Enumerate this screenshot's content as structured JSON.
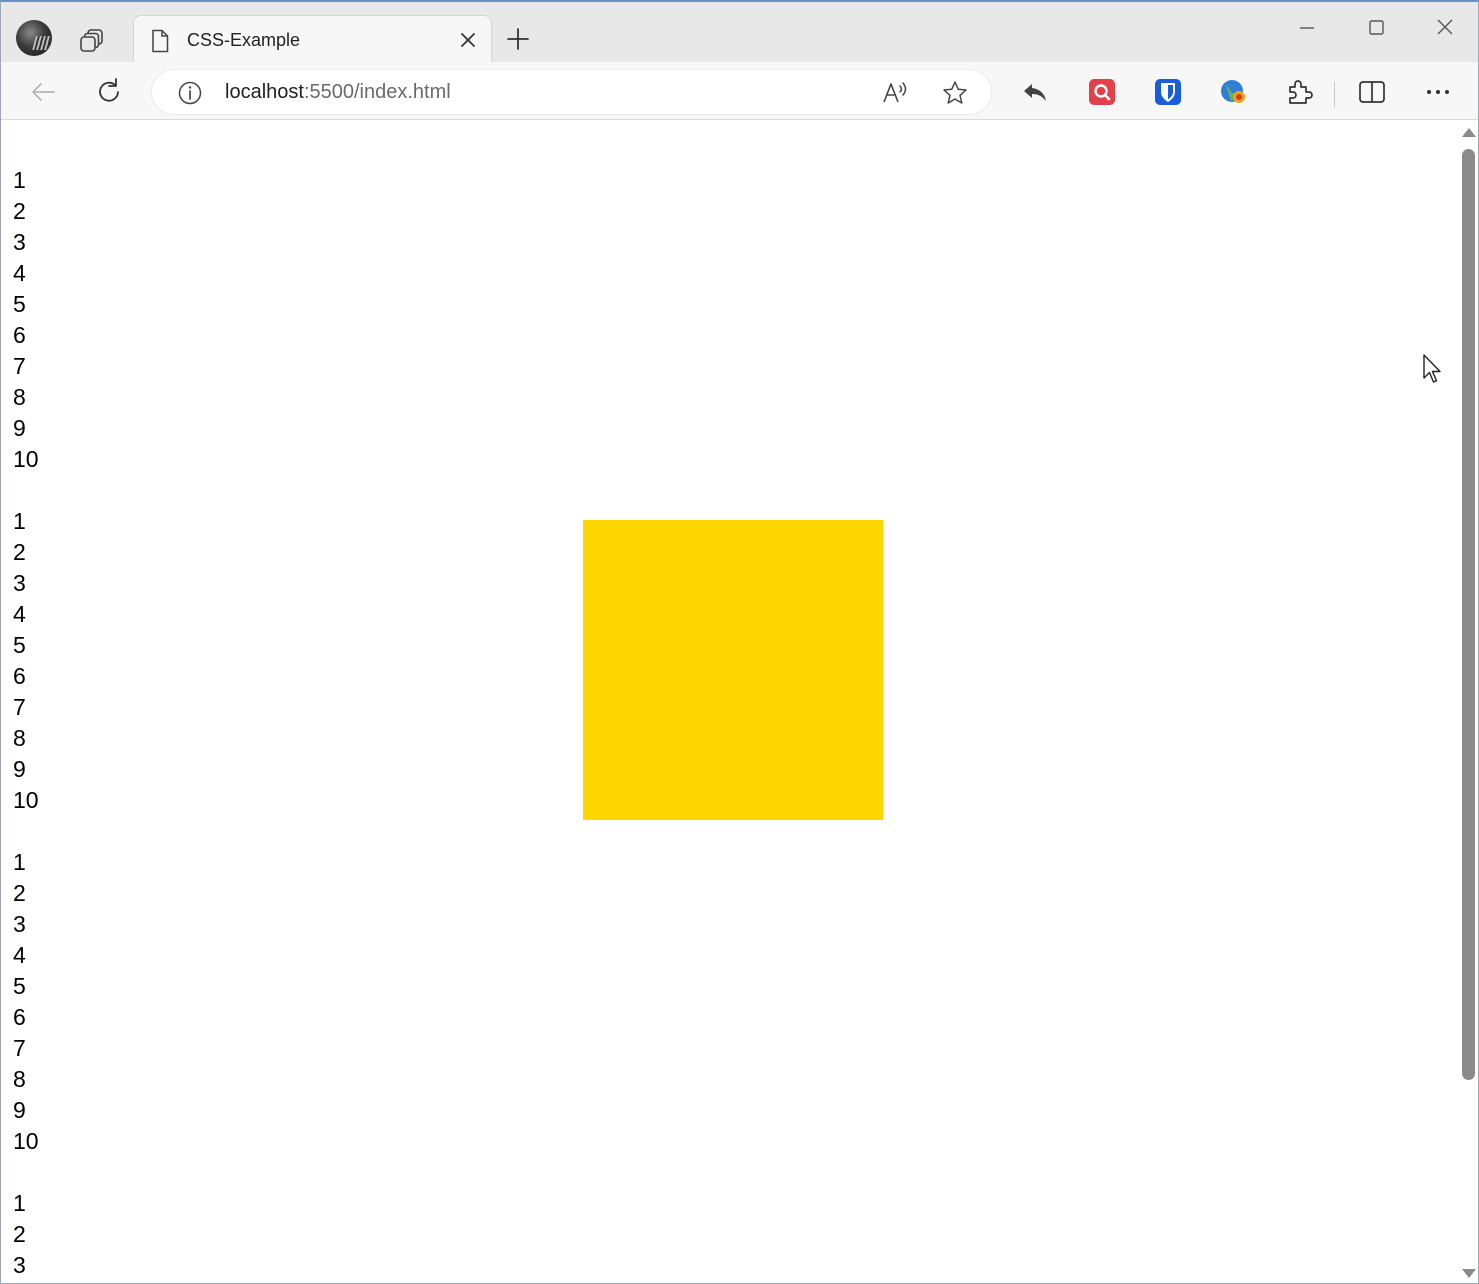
{
  "browser": {
    "tab": {
      "title": "CSS-Example"
    },
    "address": {
      "host": "localhost",
      "rest": ":5500/index.html"
    }
  },
  "page": {
    "groups": [
      [
        "1",
        "2",
        "3",
        "4",
        "5",
        "6",
        "7",
        "8",
        "9",
        "10"
      ],
      [
        "1",
        "2",
        "3",
        "4",
        "5",
        "6",
        "7",
        "8",
        "9",
        "10"
      ],
      [
        "1",
        "2",
        "3",
        "4",
        "5",
        "6",
        "7",
        "8",
        "9",
        "10"
      ],
      [
        "1",
        "2",
        "3"
      ]
    ],
    "box_color": "#FFD700"
  },
  "icons": {
    "profile": "profile-avatar",
    "tab_actions": "tab-actions-icon",
    "back": "back-arrow-icon",
    "reload": "reload-icon",
    "info": "info-icon",
    "read_aloud": "read-aloud-icon",
    "favorite": "star-icon",
    "extensions": [
      "share-icon",
      "red-search-extension-icon",
      "bitwarden-icon",
      "globe-extension-icon",
      "puzzle-icon"
    ],
    "split": "split-screen-icon",
    "more": "more-icon"
  }
}
